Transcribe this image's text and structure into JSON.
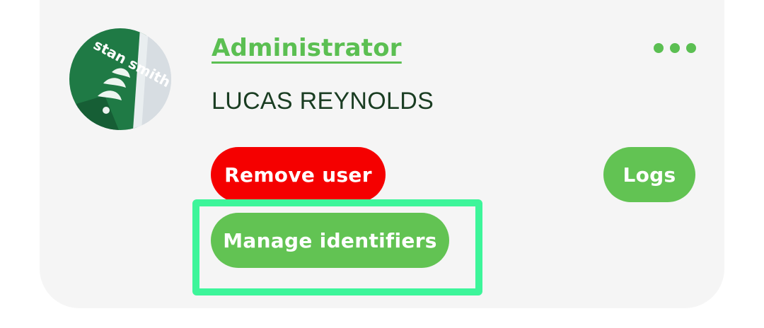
{
  "user_card": {
    "role_label": "Administrator",
    "user_name": "LUCAS REYNOLDS",
    "more_icon": "more-horizontal-icon",
    "actions": {
      "remove_label": "Remove user",
      "logs_label": "Logs",
      "manage_label": "Manage identifiers"
    },
    "avatar_text": "stan smith"
  },
  "colors": {
    "accent_green": "#62c353",
    "danger_red": "#f50000",
    "highlight_green": "#3df59a",
    "card_background": "#f5f5f5",
    "name_text": "#1a3d22"
  }
}
